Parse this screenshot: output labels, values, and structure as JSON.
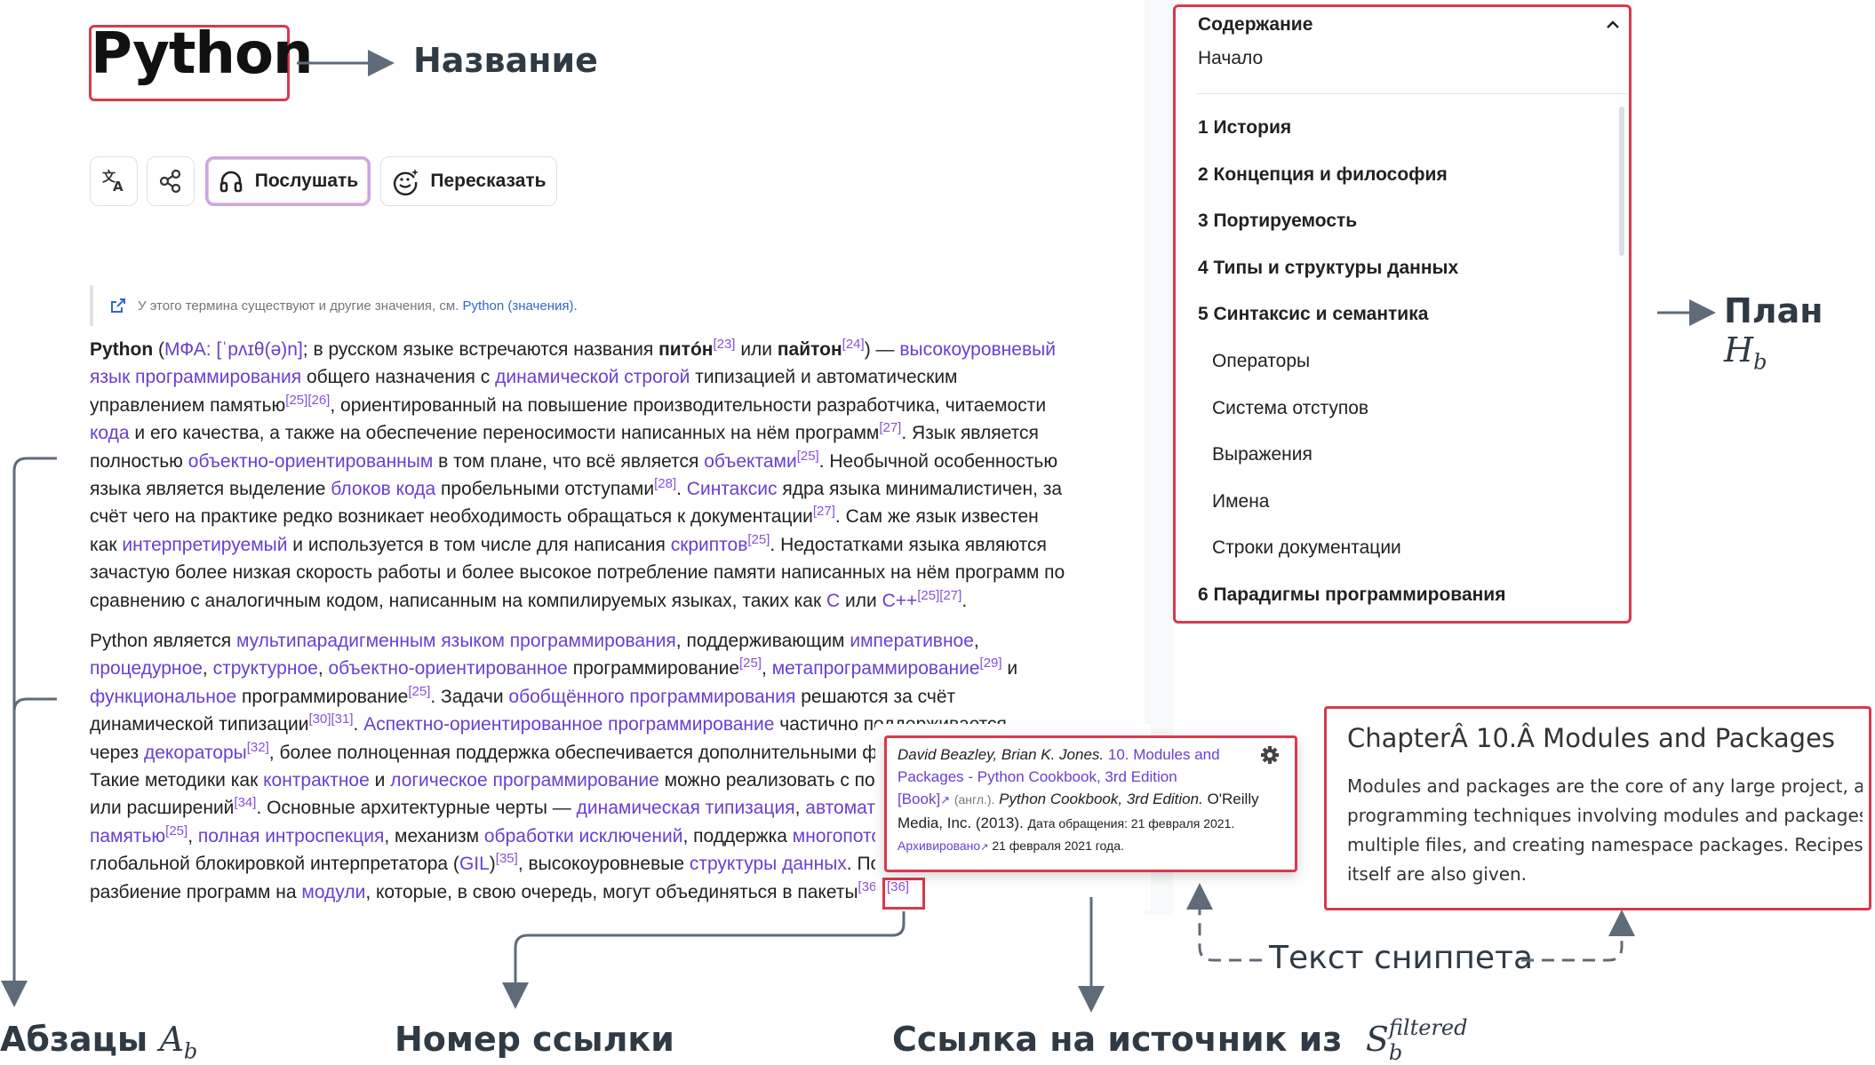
{
  "article": {
    "title": "Python",
    "toolbar": {
      "listen_label": "Послушать",
      "retell_label": "Пересказать"
    },
    "hatnote": {
      "text": "У этого термина существуют и другие значения, см.",
      "link": "Python (значения)."
    }
  },
  "toc": {
    "heading": "Содержание",
    "start": "Начало",
    "items": [
      {
        "label": "1 История",
        "level": 1
      },
      {
        "label": "2 Концепция и философия",
        "level": 1
      },
      {
        "label": "3 Портируемость",
        "level": 1
      },
      {
        "label": "4 Типы и структуры данных",
        "level": 1
      },
      {
        "label": "5 Синтаксис и семантика",
        "level": 1
      },
      {
        "label": "Операторы",
        "level": 2
      },
      {
        "label": "Система отступов",
        "level": 2
      },
      {
        "label": "Выражения",
        "level": 2
      },
      {
        "label": "Имена",
        "level": 2
      },
      {
        "label": "Строки документации",
        "level": 2
      },
      {
        "label": "6 Парадигмы программирования",
        "level": 1
      }
    ]
  },
  "popup": {
    "line1_author": "David Beazley, Brian K. Jones.",
    "line1_link": "10. Modules and",
    "line2_link": "Packages - Python Cookbook, 3rd Edition",
    "line3_book": "[Book]",
    "line3_lang": "(англ.).",
    "line3_title": "Python Cookbook, 3rd Edition.",
    "line3_pub": "O'Reilly",
    "line4_media": "Media, Inc. (2013).",
    "line4_access": "Дата обращения: 21 февраля 2021.",
    "line5_archived": "Архивировано",
    "line5_date": "21 февраля 2021 года."
  },
  "snippet": {
    "title": "ChapterÂ 10.Â Modules and Packages",
    "lines": [
      "Modules and packages are the core of any large project, an",
      "programming techniques involving modules and packages",
      "multiple files, and creating namespace packages. Recipes t",
      "itself are also given."
    ]
  },
  "annotations": {
    "title_label": "Название",
    "plan_label": "План",
    "plan_math": "H",
    "plan_sub": "b",
    "paras_label": "Абзацы",
    "paras_math": "A",
    "paras_sub": "b",
    "refnum_label": "Номер ссылки",
    "source_label": "Ссылка на источник из",
    "source_math": "S",
    "source_sub": "b",
    "source_sup": "filtered",
    "snippet_label": "Текст сниппета"
  },
  "colors": {
    "highlight_box": "#d8394c",
    "link": "#6a3fd0",
    "annotation_arrow": "#5f6b78"
  }
}
